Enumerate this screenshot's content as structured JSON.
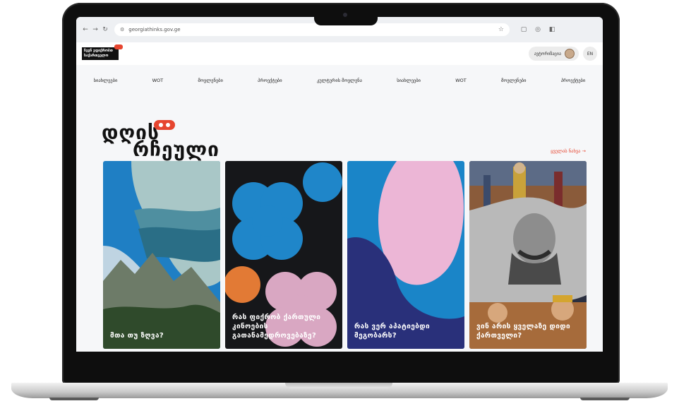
{
  "browser": {
    "url": "georgiathinks.gov.ge",
    "nav_back": "←",
    "nav_forward": "→",
    "nav_reload": "↻",
    "site_info": "⚙",
    "bookmark": "☆",
    "icon_extensions": "▢",
    "icon_cast": "◎",
    "icon_sidepanel": "◧"
  },
  "header": {
    "logo_text_line1": "ჩვენ ვფიქრობთ",
    "logo_text_line2": "საქართველო",
    "login_label": "ავტორიზაცია",
    "lang_label": "EN"
  },
  "menu": {
    "items": [
      "სიახლეები",
      "WOT",
      "მოვლენები",
      "პროექტები",
      "კულტურის მოვლენა",
      "სიახლეები",
      "WOT",
      "მოვლენები",
      "პროექტები"
    ]
  },
  "section": {
    "title_line1": "დღის",
    "title_line2": "რჩეული",
    "see_all": "ყველას ნახვა →"
  },
  "cards": [
    {
      "caption": "მთა თუ ზღვა?"
    },
    {
      "caption": "რას ფიქრობ ქართული კინოების გათანამედროვებაზე?"
    },
    {
      "caption": "რას ვერ აპატიებდი მეგობარს?"
    },
    {
      "caption": "ვინ არის ყველაზე დიდი ქართველი?"
    }
  ],
  "colors": {
    "accent": "#e6452f",
    "card1": "#1f7fc4",
    "card2": "#16171a",
    "card3": "#1a85c8",
    "card2_shape_blue": "#1f86c9",
    "card2_shape_pink": "#d9a7c2",
    "card2_shape_orange": "#e27a35",
    "card3_shape_pink": "#ecb6d6",
    "card3_shape_navy": "#29307a"
  }
}
